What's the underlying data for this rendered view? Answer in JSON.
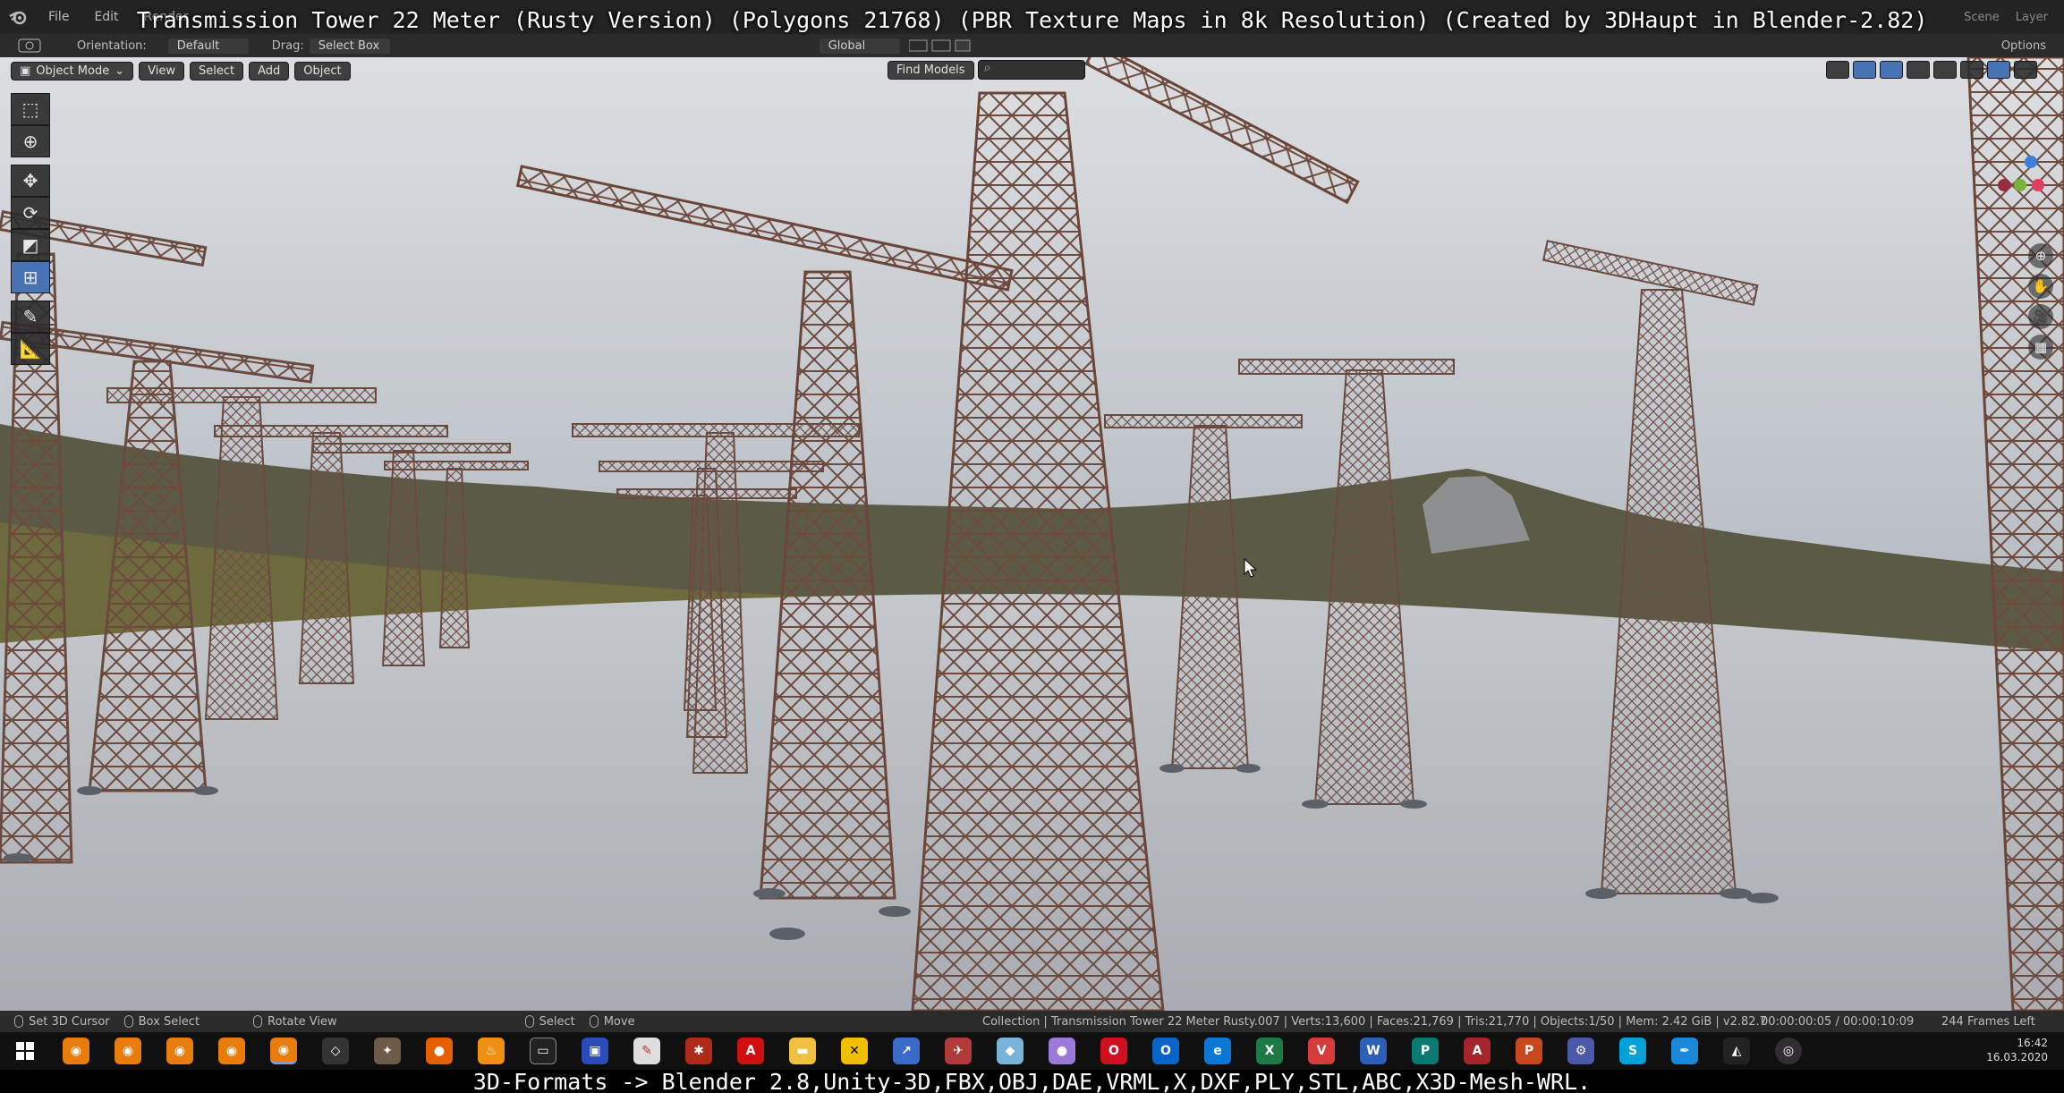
{
  "overlay_title": "Transmission Tower 22 Meter (Rusty Version) (Polygons 21768) (PBR Texture Maps in 8k Resolution) (Created by 3DHaupt in Blender-2.82)",
  "menu": {
    "items": [
      "File",
      "Edit",
      "Render"
    ],
    "right": [
      "Scene",
      "Layer"
    ]
  },
  "tool_header": {
    "orientation_label": "Orientation:",
    "orientation_value": "Default",
    "drag_label": "Drag:",
    "drag_value": "Select Box",
    "transform_orientation": "Global",
    "options": "Options"
  },
  "viewport_header": {
    "mode": "Object Mode",
    "view": "View",
    "select": "Select",
    "add": "Add",
    "object": "Object",
    "find_models": "Find Models"
  },
  "status_bar": {
    "hint1": "Set 3D Cursor",
    "hint2": "Box Select",
    "hint3": "Rotate View",
    "hint4": "Select",
    "hint5": "Move",
    "stats": "Collection | Transmission Tower 22 Meter Rusty.007 | Verts:13,600 | Faces:21,769 | Tris:21,770 | Objects:1/50 | Mem: 2.42 GiB | v2.82.7",
    "time": "00:00:00:05 / 00:00:10:09",
    "frames": "244 Frames Left"
  },
  "taskbar": {
    "time": "16:42",
    "date": "16.03.2020"
  },
  "bottom_caption": "3D-Formats -> Blender 2.8,Unity-3D,FBX,OBJ,DAE,VRML,X,DXF,PLY,STL,ABC,X3D-Mesh-WRL.",
  "colors": {
    "accent": "#4772b3",
    "rust": "#7a5042",
    "ground": "#b8bcc2",
    "sky": "#d2d5d9"
  },
  "icons": [
    "blender-logo",
    "select-box-icon",
    "cursor-icon",
    "move-icon",
    "rotate-icon",
    "scale-icon",
    "transform-icon",
    "annotate-icon",
    "measure-icon",
    "windows-start-icon"
  ]
}
